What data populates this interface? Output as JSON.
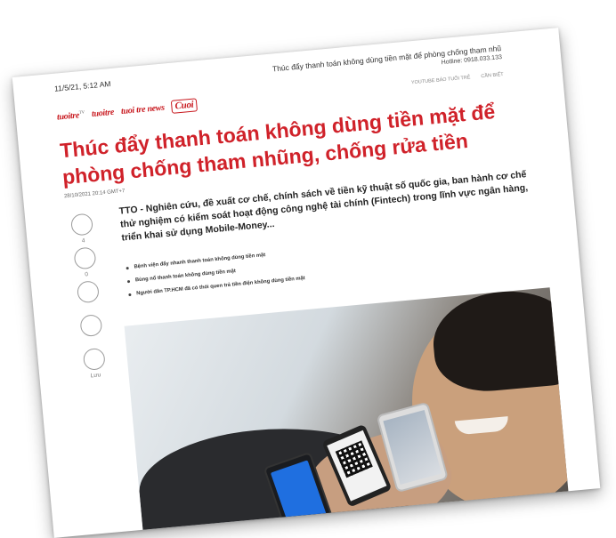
{
  "print_header": {
    "datetime": "11/5/21, 5:12 AM",
    "doc_title": "Thúc đẩy thanh toán không dùng tiền mặt để phòng chống tham nhũ",
    "hotline": "Hotline: 0918.033.133"
  },
  "brands": [
    {
      "label": "tuoitre",
      "sup": "TV"
    },
    {
      "label": "tuoitre"
    },
    {
      "label": "tuoi tre news"
    },
    {
      "label": "Cuoi"
    }
  ],
  "nav": {
    "youtube": "YOUTUBE BÁO TUỔI TRẺ",
    "search": "CẦN BIẾT"
  },
  "article": {
    "title": "Thúc đẩy thanh toán không dùng tiền mặt để phòng chống tham nhũng, chống rửa tiền",
    "date": "28/10/2021 20:14 GMT+7",
    "lead": "TTO - Nghiên cứu, đề xuất cơ chế, chính sách về tiền kỹ thuật số quốc gia, ban hành cơ chế thử nghiệm có kiểm soát hoạt động công nghệ tài chính (Fintech) trong lĩnh vực ngân hàng, triển khai sử dụng Mobile-Money...",
    "related": [
      "Bệnh viện đẩy nhanh thanh toán không dùng tiền mặt",
      "Bùng nổ thanh toán không dùng tiền mặt",
      "Người dân TP.HCM đã có thói quen trả tiền điện không dùng tiền mặt"
    ]
  },
  "rail": {
    "like_count": "4",
    "comment_count": "0",
    "save_label": "Lưu"
  },
  "colors": {
    "brand_red": "#d0222a"
  }
}
